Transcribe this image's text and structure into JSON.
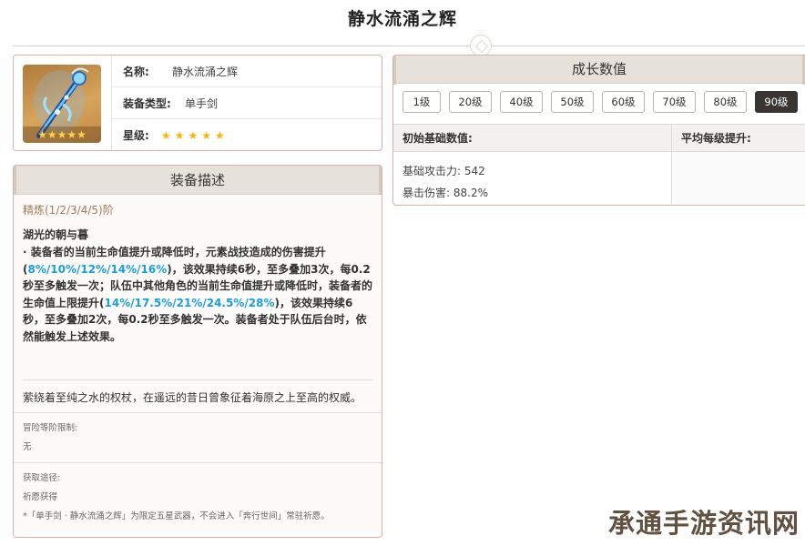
{
  "page": {
    "title": "静水流涌之辉"
  },
  "info": {
    "name_label": "名称:",
    "name_value": "静水流涌之辉",
    "type_label": "装备类型:",
    "type_value": "单手剑",
    "rarity_label": "星级:",
    "rarity_stars": "★★★★★",
    "thumb_stars": "★★★★★",
    "thumb_icon": "sword-icon"
  },
  "description": {
    "header": "装备描述",
    "refine": "精炼(1/2/3/4/5)阶",
    "skill_name": "湖光的朝与暮",
    "skill_text_1": "· 装备者的当前生命值提升或降低时，元素战技造成的伤害提升(",
    "skill_highlight_1": "8%/10%/12%/14%/16%",
    "skill_text_2": ")，该效果持续6秒，至多叠加3次，每0.2秒至多触发一次；队伍中其他角色的当前生命值提升或降低时，装备者的生命值上限提升(",
    "skill_highlight_2": "14%/17.5%/21%/24.5%/28%",
    "skill_text_3": ")，该效果持续6秒，至多叠加2次，每0.2秒至多触发一次。装备者处于队伍后台时，依然能触发上述效果。",
    "lore": "萦绕着至纯之水的权杖，在遥远的昔日曾象征着海原之上至高的权威。",
    "ascension_label": "冒险等阶限制:",
    "ascension_value": "无",
    "source_label": "获取途径:",
    "source_value": "祈愿获得",
    "note": "*「单手剑 · 静水流涌之辉」为限定五星武器，不会进入「奔行世间」常驻祈愿。"
  },
  "growth": {
    "header": "成长数值",
    "levels": [
      "1级",
      "20级",
      "40级",
      "50级",
      "60级",
      "70级",
      "80级",
      "90级"
    ],
    "active_level": "90级",
    "col_base": "初始基础数值:",
    "col_avg": "平均每级提升:",
    "atk_label": "基础攻击力:",
    "atk_value": "542",
    "crit_label": "暴击伤害:",
    "crit_value": "88.2%"
  },
  "watermark": "承通手游资讯网",
  "colors": {
    "accent_blue": "#1aa0d8",
    "card_border": "#d7b3a6",
    "header_bg": "#e7e1db",
    "star": "#f5b50a"
  }
}
